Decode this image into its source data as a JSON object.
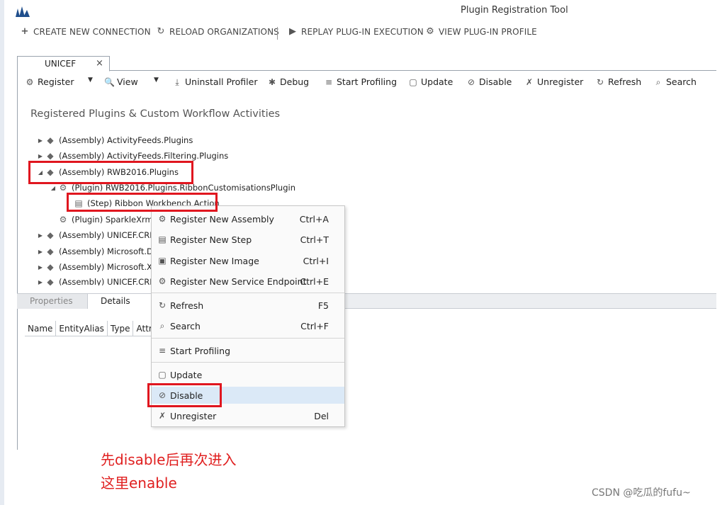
{
  "window": {
    "title": "Plugin Registration Tool"
  },
  "top_toolbar": [
    {
      "label": "CREATE NEW CONNECTION",
      "icon": "plus-icon"
    },
    {
      "label": "RELOAD ORGANIZATIONS",
      "icon": "reload-icon"
    },
    {
      "label": "REPLAY PLUG-IN EXECUTION",
      "icon": "play-icon"
    },
    {
      "label": "VIEW PLUG-IN PROFILE",
      "icon": "profile-icon"
    }
  ],
  "tab": {
    "label": "UNICEF",
    "close": "×"
  },
  "commands": [
    {
      "label": "Register",
      "icon": "register-icon"
    },
    {
      "label": "View",
      "icon": "view-icon"
    },
    {
      "label": "Uninstall Profiler",
      "icon": "uninstall-icon"
    },
    {
      "label": "Debug",
      "icon": "debug-icon"
    },
    {
      "label": "Start Profiling",
      "icon": "profiling-icon"
    },
    {
      "label": "Update",
      "icon": "update-icon"
    },
    {
      "label": "Disable",
      "icon": "disable-icon"
    },
    {
      "label": "Unregister",
      "icon": "unregister-icon"
    },
    {
      "label": "Refresh",
      "icon": "refresh-icon"
    },
    {
      "label": "Search",
      "icon": "search-icon"
    }
  ],
  "section_title": "Registered Plugins & Custom Workflow Activities",
  "tree": [
    {
      "label": "(Assembly) ActivityFeeds.Plugins",
      "icon": "assembly-icon"
    },
    {
      "label": "(Assembly) ActivityFeeds.Filtering.Plugins",
      "icon": "assembly-icon"
    },
    {
      "label": "(Assembly) RWB2016.Plugins",
      "icon": "assembly-icon"
    },
    {
      "label": "(Plugin) RWB2016.Plugins.RibbonCustomisationsPlugin",
      "icon": "plugin-icon"
    },
    {
      "label": "(Step) Ribbon Workbench Action",
      "icon": "step-icon"
    },
    {
      "label": "(Plugin) SparkleXrm",
      "icon": "plugin-icon"
    },
    {
      "label": "(Assembly) UNICEF.CRM",
      "icon": "assembly-icon"
    },
    {
      "label": "(Assembly) Microsoft.D",
      "icon": "assembly-icon"
    },
    {
      "label": "(Assembly) Microsoft.X",
      "icon": "assembly-icon"
    },
    {
      "label": "(Assembly) UNICEF.CRM",
      "icon": "assembly-icon"
    }
  ],
  "bottom_tabs": {
    "properties": "Properties",
    "details": "Details"
  },
  "grid_columns": [
    "Name",
    "EntityAlias",
    "Type",
    "Attr"
  ],
  "context_menu": [
    {
      "label": "Register New Assembly",
      "shortcut": "Ctrl+A",
      "icon": "assembly-add-icon"
    },
    {
      "label": "Register New Step",
      "shortcut": "Ctrl+T",
      "icon": "register-step-icon"
    },
    {
      "label": "Register New Image",
      "shortcut": "Ctrl+I",
      "icon": "image-icon"
    },
    {
      "label": "Register New Service Endpoint",
      "shortcut": "Ctrl+E",
      "icon": "endpoint-icon"
    },
    {
      "label": "Refresh",
      "shortcut": "F5",
      "icon": "refresh-icon"
    },
    {
      "label": "Search",
      "shortcut": "Ctrl+F",
      "icon": "search-icon"
    },
    {
      "label": "Start Profiling",
      "shortcut": "",
      "icon": "profiling-icon"
    },
    {
      "label": "Update",
      "shortcut": "",
      "icon": "update-icon"
    },
    {
      "label": "Disable",
      "shortcut": "",
      "icon": "disable-icon"
    },
    {
      "label": "Unregister",
      "shortcut": "Del",
      "icon": "unregister-icon"
    }
  ],
  "annotation": {
    "line1": "先disable后再次进入",
    "line2": "这里enable"
  },
  "watermark": "CSDN @吃瓜的fufu~",
  "colors": {
    "highlight_box": "#e0161f",
    "annotation_text": "#e02020",
    "menu_highlight": "#dbe9f7"
  }
}
